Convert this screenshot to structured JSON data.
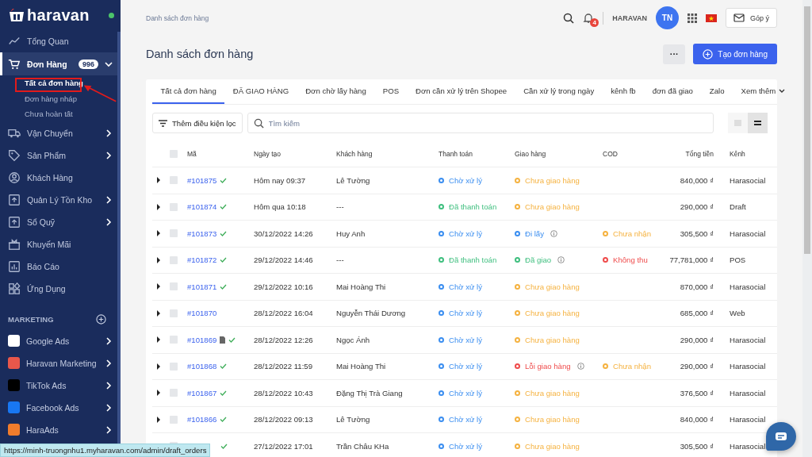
{
  "sidebar": {
    "logo": "haravan",
    "online": true,
    "items": [
      {
        "label": "Tổng Quan",
        "chevron": false,
        "selected": false
      },
      {
        "label": "Đơn Hàng",
        "badge": "996",
        "chevron": true,
        "expanded": true,
        "selected": true,
        "children": [
          {
            "label": "Tất cả đơn hàng",
            "selected": true
          },
          {
            "label": "Đơn hàng nháp",
            "selected": false
          },
          {
            "label": "Chưa hoàn tất",
            "selected": false
          }
        ]
      },
      {
        "label": "Vận Chuyển",
        "chevron": true,
        "selected": false
      },
      {
        "label": "Sản Phẩm",
        "chevron": true,
        "selected": false
      },
      {
        "label": "Khách Hàng",
        "chevron": false,
        "selected": false
      },
      {
        "label": "Quản Lý Tồn Kho",
        "chevron": true,
        "selected": false
      },
      {
        "label": "Sổ Quỹ",
        "chevron": true,
        "selected": false
      },
      {
        "label": "Khuyến Mãi",
        "chevron": false,
        "selected": false
      },
      {
        "label": "Báo Cáo",
        "chevron": false,
        "selected": false
      },
      {
        "label": "Ứng Dụng",
        "chevron": false,
        "selected": false
      }
    ],
    "section": "MARKETING",
    "apps": [
      {
        "label": "Google Ads",
        "color": "#ffffff"
      },
      {
        "label": "Haravan Marketing",
        "color": "#e8574b"
      },
      {
        "label": "TikTok Ads",
        "color": "#000000"
      },
      {
        "label": "Facebook Ads",
        "color": "#1877f2"
      },
      {
        "label": "HaraAds",
        "color": "#f07c2c"
      }
    ]
  },
  "topbar": {
    "breadcrumb": "Danh sách đơn hàng",
    "notifications": "4",
    "store": "HARAVAN",
    "avatar": "TN",
    "feedback": "Góp ý"
  },
  "page": {
    "title": "Danh sách đơn hàng",
    "more": "···",
    "create": "Tạo đơn hàng"
  },
  "tabs": [
    {
      "label": "Tất cả đơn hàng",
      "selected": true
    },
    {
      "label": "ĐÃ GIAO HÀNG",
      "selected": false
    },
    {
      "label": "Đơn chờ lấy hàng",
      "selected": false
    },
    {
      "label": "POS",
      "selected": false
    },
    {
      "label": "Đơn cần xử lý trên Shopee",
      "selected": false
    },
    {
      "label": "Cần xử lý trong ngày",
      "selected": false
    },
    {
      "label": "kênh fb",
      "selected": false
    },
    {
      "label": "đơn đã giao",
      "selected": false
    },
    {
      "label": "Zalo",
      "selected": false
    },
    {
      "label": "Xem thêm",
      "selected": false,
      "dropdown": true
    }
  ],
  "filter": {
    "label": "Thêm điều kiện lọc",
    "search_placeholder": "Tìm kiếm",
    "views": [
      {
        "kind": "list",
        "selected": false
      },
      {
        "kind": "compact",
        "selected": true
      }
    ]
  },
  "table": {
    "all_checked": false,
    "columns": [
      "Mã",
      "Ngày tạo",
      "Khách hàng",
      "Thanh toán",
      "Giao hàng",
      "COD",
      "Tổng tiền",
      "Kênh"
    ],
    "rows": [
      {
        "order": "#101875",
        "checked": false,
        "verified": true,
        "note": false,
        "date": "Hôm nay 09:37",
        "customer": "Lê Tường",
        "payment": {
          "text": "Chờ xử lý",
          "color": "#3b8ef0"
        },
        "delivery": {
          "text": "Chưa giao hàng",
          "color": "#f5b240",
          "info": false
        },
        "total": "840,000 ₫",
        "channel": "Harasocial"
      },
      {
        "order": "#101874",
        "checked": false,
        "verified": true,
        "note": false,
        "date": "Hôm qua 10:18",
        "customer": "---",
        "payment": {
          "text": "Đã thanh toán",
          "color": "#3fbf7f"
        },
        "delivery": {
          "text": "Chưa giao hàng",
          "color": "#f5b240",
          "info": false
        },
        "total": "290,000 ₫",
        "channel": "Draft"
      },
      {
        "order": "#101873",
        "checked": false,
        "verified": true,
        "note": false,
        "date": "30/12/2022 14:26",
        "customer": "Huy Anh",
        "payment": {
          "text": "Chờ xử lý",
          "color": "#3b8ef0"
        },
        "delivery": {
          "text": "Đi lấy",
          "color": "#3b8ef0",
          "info": true
        },
        "cod": {
          "text": "Chưa nhận",
          "color": "#f5b240"
        },
        "total": "305,500 ₫",
        "channel": "Harasocial"
      },
      {
        "order": "#101872",
        "checked": false,
        "verified": true,
        "note": false,
        "date": "29/12/2022 14:46",
        "customer": "---",
        "payment": {
          "text": "Đã thanh toán",
          "color": "#3fbf7f"
        },
        "delivery": {
          "text": "Đã giao",
          "color": "#3fbf7f",
          "info": true
        },
        "cod": {
          "text": "Không thu",
          "color": "#ef4b4b"
        },
        "total": "77,781,000 ₫",
        "channel": "POS"
      },
      {
        "order": "#101871",
        "checked": false,
        "verified": true,
        "note": false,
        "date": "29/12/2022 10:16",
        "customer": "Mai Hoàng Thi",
        "payment": {
          "text": "Chờ xử lý",
          "color": "#3b8ef0"
        },
        "delivery": {
          "text": "Chưa giao hàng",
          "color": "#f5b240",
          "info": false
        },
        "total": "870,000 ₫",
        "channel": "Harasocial"
      },
      {
        "order": "#101870",
        "checked": false,
        "verified": false,
        "note": false,
        "date": "28/12/2022 16:04",
        "customer": "Nguyễn Thái Dương",
        "payment": {
          "text": "Chờ xử lý",
          "color": "#3b8ef0"
        },
        "delivery": {
          "text": "Chưa giao hàng",
          "color": "#f5b240",
          "info": false
        },
        "total": "685,000 ₫",
        "channel": "Web"
      },
      {
        "order": "#101869",
        "checked": false,
        "verified": true,
        "note": true,
        "date": "28/12/2022 12:26",
        "customer": "Ngọc Ánh",
        "payment": {
          "text": "Chờ xử lý",
          "color": "#3b8ef0"
        },
        "delivery": {
          "text": "Chưa giao hàng",
          "color": "#f5b240",
          "info": false
        },
        "total": "290,000 ₫",
        "channel": "Harasocial"
      },
      {
        "order": "#101868",
        "checked": false,
        "verified": true,
        "note": false,
        "date": "28/12/2022 11:59",
        "customer": "Mai Hoàng Thi",
        "payment": {
          "text": "Chờ xử lý",
          "color": "#3b8ef0"
        },
        "delivery": {
          "text": "Lỗi giao hàng",
          "color": "#ef4b4b",
          "info": true
        },
        "cod": {
          "text": "Chưa nhận",
          "color": "#f5b240"
        },
        "total": "290,000 ₫",
        "channel": "Harasocial"
      },
      {
        "order": "#101867",
        "checked": false,
        "verified": true,
        "note": false,
        "date": "28/12/2022 10:43",
        "customer": "Đặng Thị Trà Giang",
        "payment": {
          "text": "Chờ xử lý",
          "color": "#3b8ef0"
        },
        "delivery": {
          "text": "Chưa giao hàng",
          "color": "#f5b240",
          "info": false
        },
        "total": "376,500 ₫",
        "channel": "Harasocial"
      },
      {
        "order": "#101866",
        "checked": false,
        "verified": true,
        "note": false,
        "date": "28/12/2022 09:13",
        "customer": "Lê Tường",
        "payment": {
          "text": "Chờ xử lý",
          "color": "#3b8ef0"
        },
        "delivery": {
          "text": "Chưa giao hàng",
          "color": "#f5b240",
          "info": false
        },
        "total": "840,000 ₫",
        "channel": "Harasocial"
      },
      {
        "checked": false,
        "verified": true,
        "note": false,
        "date": "27/12/2022 17:01",
        "customer": "Trần Châu KHa",
        "payment": {
          "text": "Chờ xử lý",
          "color": "#3b8ef0"
        },
        "delivery": {
          "text": "Chưa giao hàng",
          "color": "#f5b240",
          "info": false
        },
        "total": "305,500 ₫",
        "channel": "Harasocial"
      }
    ]
  },
  "status_url": "https://minh-truongnhu1.myharavan.com/admin/draft_orders"
}
